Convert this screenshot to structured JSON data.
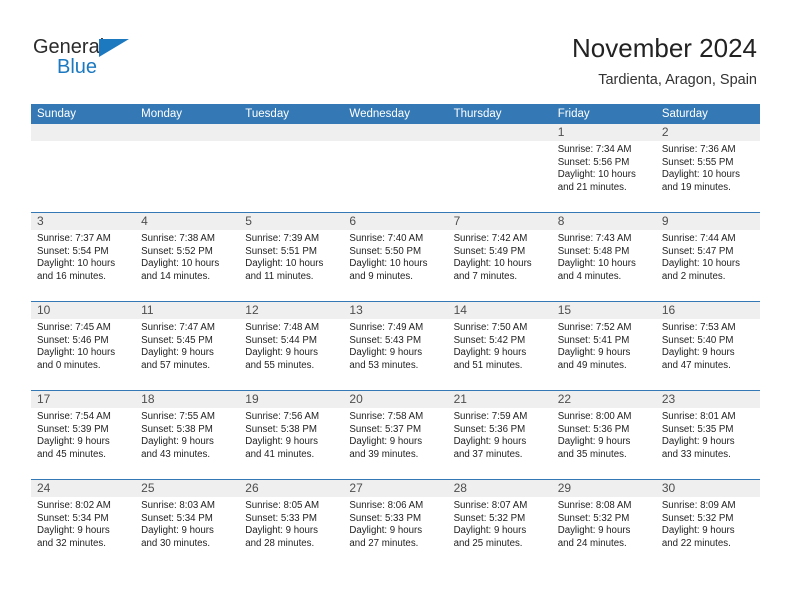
{
  "logo": {
    "word_one": "General",
    "word_two": "Blue",
    "flag_icon": "blue-triangle-flag-icon",
    "accent_color": "#1c79c0"
  },
  "header": {
    "title": "November 2024",
    "subtitle": "Tardienta, Aragon, Spain"
  },
  "theme": {
    "header_blue": "#3479b5",
    "day_band_gray": "#efefef",
    "cell_white": "#ffffff",
    "text_dark": "#1f1f1f"
  },
  "calendar": {
    "weekdays": [
      "Sunday",
      "Monday",
      "Tuesday",
      "Wednesday",
      "Thursday",
      "Friday",
      "Saturday"
    ],
    "weeks": [
      [
        {
          "day": "",
          "empty": true
        },
        {
          "day": "",
          "empty": true
        },
        {
          "day": "",
          "empty": true
        },
        {
          "day": "",
          "empty": true
        },
        {
          "day": "",
          "empty": true
        },
        {
          "day": "1",
          "sunrise": "Sunrise: 7:34 AM",
          "sunset": "Sunset: 5:56 PM",
          "daylight_1": "Daylight: 10 hours",
          "daylight_2": "and 21 minutes."
        },
        {
          "day": "2",
          "sunrise": "Sunrise: 7:36 AM",
          "sunset": "Sunset: 5:55 PM",
          "daylight_1": "Daylight: 10 hours",
          "daylight_2": "and 19 minutes."
        }
      ],
      [
        {
          "day": "3",
          "sunrise": "Sunrise: 7:37 AM",
          "sunset": "Sunset: 5:54 PM",
          "daylight_1": "Daylight: 10 hours",
          "daylight_2": "and 16 minutes."
        },
        {
          "day": "4",
          "sunrise": "Sunrise: 7:38 AM",
          "sunset": "Sunset: 5:52 PM",
          "daylight_1": "Daylight: 10 hours",
          "daylight_2": "and 14 minutes."
        },
        {
          "day": "5",
          "sunrise": "Sunrise: 7:39 AM",
          "sunset": "Sunset: 5:51 PM",
          "daylight_1": "Daylight: 10 hours",
          "daylight_2": "and 11 minutes."
        },
        {
          "day": "6",
          "sunrise": "Sunrise: 7:40 AM",
          "sunset": "Sunset: 5:50 PM",
          "daylight_1": "Daylight: 10 hours",
          "daylight_2": "and 9 minutes."
        },
        {
          "day": "7",
          "sunrise": "Sunrise: 7:42 AM",
          "sunset": "Sunset: 5:49 PM",
          "daylight_1": "Daylight: 10 hours",
          "daylight_2": "and 7 minutes."
        },
        {
          "day": "8",
          "sunrise": "Sunrise: 7:43 AM",
          "sunset": "Sunset: 5:48 PM",
          "daylight_1": "Daylight: 10 hours",
          "daylight_2": "and 4 minutes."
        },
        {
          "day": "9",
          "sunrise": "Sunrise: 7:44 AM",
          "sunset": "Sunset: 5:47 PM",
          "daylight_1": "Daylight: 10 hours",
          "daylight_2": "and 2 minutes."
        }
      ],
      [
        {
          "day": "10",
          "sunrise": "Sunrise: 7:45 AM",
          "sunset": "Sunset: 5:46 PM",
          "daylight_1": "Daylight: 10 hours",
          "daylight_2": "and 0 minutes."
        },
        {
          "day": "11",
          "sunrise": "Sunrise: 7:47 AM",
          "sunset": "Sunset: 5:45 PM",
          "daylight_1": "Daylight: 9 hours",
          "daylight_2": "and 57 minutes."
        },
        {
          "day": "12",
          "sunrise": "Sunrise: 7:48 AM",
          "sunset": "Sunset: 5:44 PM",
          "daylight_1": "Daylight: 9 hours",
          "daylight_2": "and 55 minutes."
        },
        {
          "day": "13",
          "sunrise": "Sunrise: 7:49 AM",
          "sunset": "Sunset: 5:43 PM",
          "daylight_1": "Daylight: 9 hours",
          "daylight_2": "and 53 minutes."
        },
        {
          "day": "14",
          "sunrise": "Sunrise: 7:50 AM",
          "sunset": "Sunset: 5:42 PM",
          "daylight_1": "Daylight: 9 hours",
          "daylight_2": "and 51 minutes."
        },
        {
          "day": "15",
          "sunrise": "Sunrise: 7:52 AM",
          "sunset": "Sunset: 5:41 PM",
          "daylight_1": "Daylight: 9 hours",
          "daylight_2": "and 49 minutes."
        },
        {
          "day": "16",
          "sunrise": "Sunrise: 7:53 AM",
          "sunset": "Sunset: 5:40 PM",
          "daylight_1": "Daylight: 9 hours",
          "daylight_2": "and 47 minutes."
        }
      ],
      [
        {
          "day": "17",
          "sunrise": "Sunrise: 7:54 AM",
          "sunset": "Sunset: 5:39 PM",
          "daylight_1": "Daylight: 9 hours",
          "daylight_2": "and 45 minutes."
        },
        {
          "day": "18",
          "sunrise": "Sunrise: 7:55 AM",
          "sunset": "Sunset: 5:38 PM",
          "daylight_1": "Daylight: 9 hours",
          "daylight_2": "and 43 minutes."
        },
        {
          "day": "19",
          "sunrise": "Sunrise: 7:56 AM",
          "sunset": "Sunset: 5:38 PM",
          "daylight_1": "Daylight: 9 hours",
          "daylight_2": "and 41 minutes."
        },
        {
          "day": "20",
          "sunrise": "Sunrise: 7:58 AM",
          "sunset": "Sunset: 5:37 PM",
          "daylight_1": "Daylight: 9 hours",
          "daylight_2": "and 39 minutes."
        },
        {
          "day": "21",
          "sunrise": "Sunrise: 7:59 AM",
          "sunset": "Sunset: 5:36 PM",
          "daylight_1": "Daylight: 9 hours",
          "daylight_2": "and 37 minutes."
        },
        {
          "day": "22",
          "sunrise": "Sunrise: 8:00 AM",
          "sunset": "Sunset: 5:36 PM",
          "daylight_1": "Daylight: 9 hours",
          "daylight_2": "and 35 minutes."
        },
        {
          "day": "23",
          "sunrise": "Sunrise: 8:01 AM",
          "sunset": "Sunset: 5:35 PM",
          "daylight_1": "Daylight: 9 hours",
          "daylight_2": "and 33 minutes."
        }
      ],
      [
        {
          "day": "24",
          "sunrise": "Sunrise: 8:02 AM",
          "sunset": "Sunset: 5:34 PM",
          "daylight_1": "Daylight: 9 hours",
          "daylight_2": "and 32 minutes."
        },
        {
          "day": "25",
          "sunrise": "Sunrise: 8:03 AM",
          "sunset": "Sunset: 5:34 PM",
          "daylight_1": "Daylight: 9 hours",
          "daylight_2": "and 30 minutes."
        },
        {
          "day": "26",
          "sunrise": "Sunrise: 8:05 AM",
          "sunset": "Sunset: 5:33 PM",
          "daylight_1": "Daylight: 9 hours",
          "daylight_2": "and 28 minutes."
        },
        {
          "day": "27",
          "sunrise": "Sunrise: 8:06 AM",
          "sunset": "Sunset: 5:33 PM",
          "daylight_1": "Daylight: 9 hours",
          "daylight_2": "and 27 minutes."
        },
        {
          "day": "28",
          "sunrise": "Sunrise: 8:07 AM",
          "sunset": "Sunset: 5:32 PM",
          "daylight_1": "Daylight: 9 hours",
          "daylight_2": "and 25 minutes."
        },
        {
          "day": "29",
          "sunrise": "Sunrise: 8:08 AM",
          "sunset": "Sunset: 5:32 PM",
          "daylight_1": "Daylight: 9 hours",
          "daylight_2": "and 24 minutes."
        },
        {
          "day": "30",
          "sunrise": "Sunrise: 8:09 AM",
          "sunset": "Sunset: 5:32 PM",
          "daylight_1": "Daylight: 9 hours",
          "daylight_2": "and 22 minutes."
        }
      ]
    ]
  }
}
